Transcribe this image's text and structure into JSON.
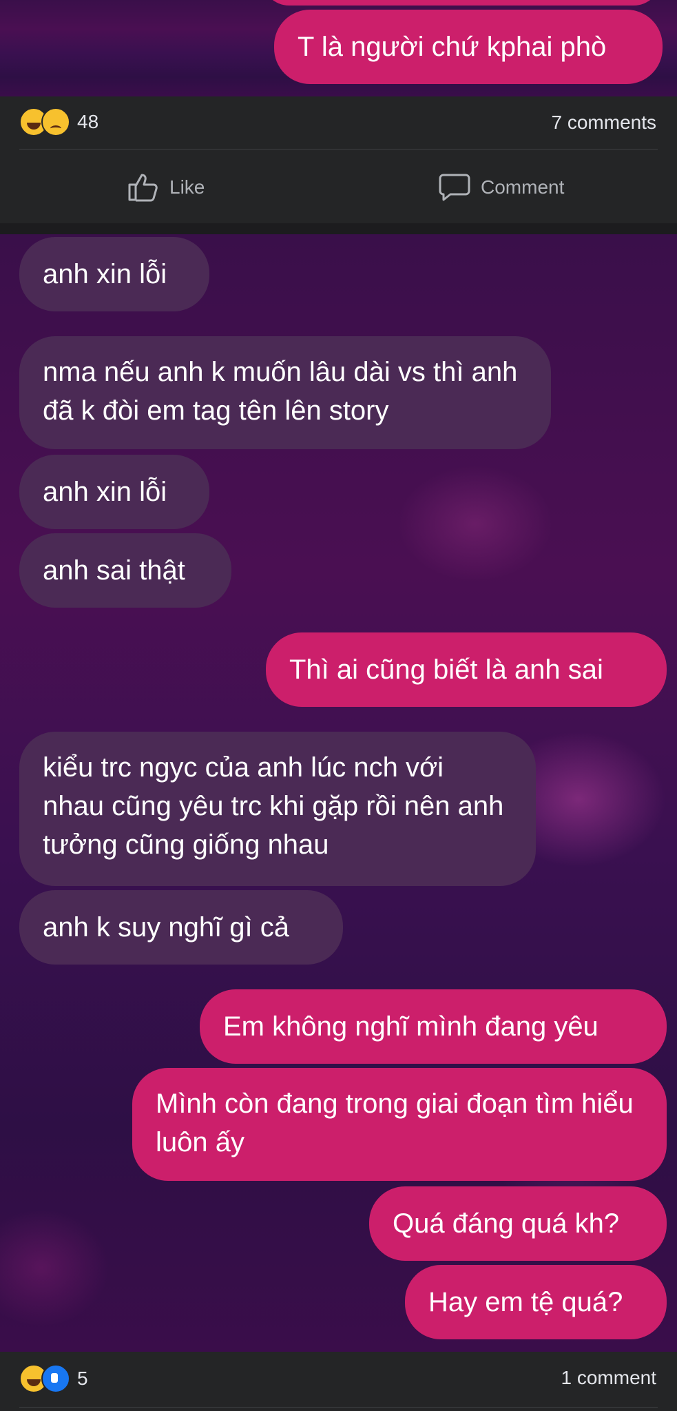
{
  "post1": {
    "messages": [
      {
        "text": "T là người chứ kphai phò"
      }
    ],
    "reaction_count": "48",
    "comments": "7 comments",
    "actions": {
      "like": "Like",
      "comment": "Comment"
    }
  },
  "post2": {
    "messages": [
      {
        "text": "anh xin lỗi"
      },
      {
        "text": "nma nếu anh k muốn lâu dài vs thì anh đã k đòi em tag tên lên story"
      },
      {
        "text": "anh xin lỗi"
      },
      {
        "text": "anh sai thật"
      },
      {
        "text": "Thì ai cũng biết là anh sai"
      },
      {
        "text": "kiểu trc ngyc của anh lúc nch với nhau cũng yêu trc khi gặp rồi nên anh tưởng cũng giống nhau"
      },
      {
        "text": "anh k suy nghĩ gì cả"
      },
      {
        "text": "Em không nghĩ mình đang yêu"
      },
      {
        "text": "Mình còn đang trong giai đoạn tìm hiểu luôn ấy"
      },
      {
        "text": "Quá đáng quá kh?"
      },
      {
        "text": "Hay em tệ quá?"
      }
    ],
    "reaction_count": "5",
    "comments": "1 comment"
  },
  "colors": {
    "incoming_bubble": "#4b2a55",
    "outgoing_bubble": "#cc1f6b",
    "bar_background": "#242526"
  }
}
